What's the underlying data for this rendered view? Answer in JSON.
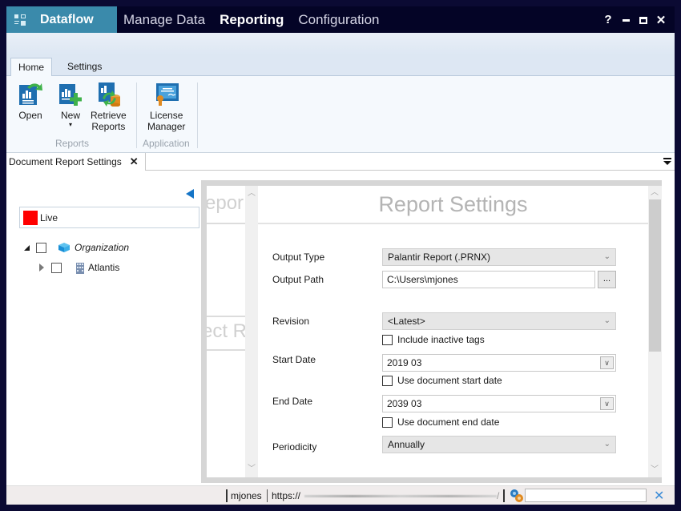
{
  "app": {
    "title": "Dataflow",
    "nav": [
      {
        "label": "Manage Data",
        "active": false
      },
      {
        "label": "Reporting",
        "active": true
      },
      {
        "label": "Configuration",
        "active": false
      }
    ],
    "window_controls": {
      "help": "?",
      "minimize": "–",
      "maximize": "☐",
      "close": "✕"
    }
  },
  "ribbon": {
    "tabs": [
      {
        "label": "Home",
        "active": true
      },
      {
        "label": "Settings",
        "active": false
      }
    ],
    "groups": [
      {
        "label": "Reports",
        "buttons": [
          {
            "label": "Open",
            "icon": "open-report-icon"
          },
          {
            "label": "New",
            "sub": "▾",
            "icon": "new-report-icon"
          },
          {
            "label": "Retrieve\nReports",
            "line1": "Retrieve",
            "line2": "Reports",
            "icon": "retrieve-reports-icon"
          }
        ]
      },
      {
        "label": "Application",
        "buttons": [
          {
            "label": "License Manager",
            "line1": "License",
            "line2": "Manager",
            "icon": "license-certificate-icon"
          }
        ]
      }
    ]
  },
  "document_tab": {
    "label": "Document Report Settings",
    "close": "✕"
  },
  "left_pane": {
    "live_label": "Live",
    "live_color": "#ff0000",
    "tree": [
      {
        "label": "Organization",
        "expanded": true,
        "checked": false,
        "icon": "organization-icon",
        "italic": true
      },
      {
        "label": "Atlantis",
        "expanded": false,
        "checked": false,
        "icon": "building-icon",
        "italic": false
      }
    ]
  },
  "ghost_pane": {
    "title_fragment": "epor",
    "section_fragment": "ect R"
  },
  "report_settings": {
    "title": "Report Settings",
    "fields": {
      "output_type": {
        "label": "Output Type",
        "value": "Palantir Report (.PRNX)"
      },
      "output_path": {
        "label": "Output Path",
        "value": "C:\\Users\\mjones",
        "browse": "..."
      },
      "revision": {
        "label": "Revision",
        "value": "<Latest>"
      },
      "include_inactive": {
        "label": "Include inactive tags",
        "checked": false
      },
      "start_date": {
        "label": "Start Date",
        "value": "2019 03"
      },
      "use_doc_start": {
        "label": "Use document start date",
        "checked": false
      },
      "end_date": {
        "label": "End Date",
        "value": "2039 03"
      },
      "use_doc_end": {
        "label": "Use document end date",
        "checked": false
      },
      "periodicity": {
        "label": "Periodicity",
        "value": "Annually"
      }
    }
  },
  "status_bar": {
    "user": "mjones",
    "url_prefix": "https://",
    "url_suffix": "/",
    "search_value": "",
    "close": "✕"
  },
  "colors": {
    "title_bar": "#040426",
    "brand": "#3a8aab",
    "accent_blue": "#1474c6",
    "live_red": "#ff0000"
  }
}
